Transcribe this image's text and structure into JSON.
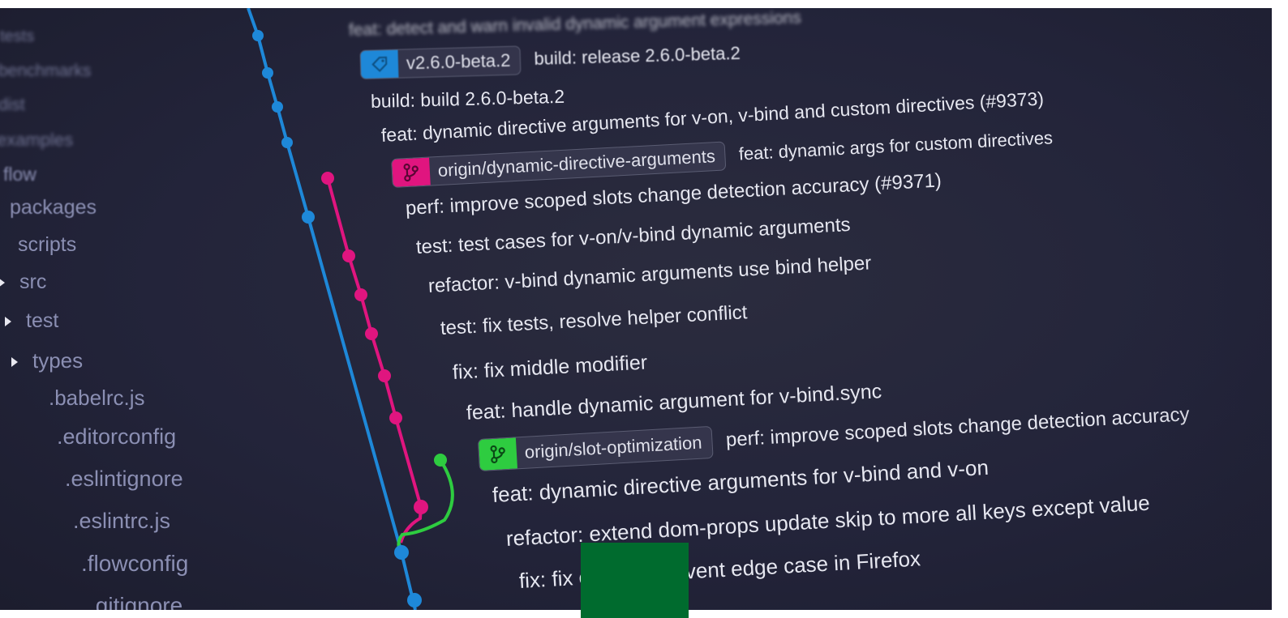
{
  "tree": {
    "items": [
      {
        "label": "tests",
        "caret": false
      },
      {
        "label": "benchmarks",
        "caret": false
      },
      {
        "label": "dist",
        "caret": false
      },
      {
        "label": "examples",
        "caret": false
      },
      {
        "label": "flow",
        "caret": false
      },
      {
        "label": "packages",
        "caret": false
      },
      {
        "label": "scripts",
        "caret": false
      },
      {
        "label": "src",
        "caret": true
      },
      {
        "label": "test",
        "caret": true
      },
      {
        "label": "types",
        "caret": true
      },
      {
        "label": ".babelrc.js",
        "caret": false
      },
      {
        "label": ".editorconfig",
        "caret": false
      },
      {
        "label": ".eslintignore",
        "caret": false
      },
      {
        "label": ".eslintrc.js",
        "caret": false
      },
      {
        "label": ".flowconfig",
        "caret": false
      },
      {
        "label": ".gitignore",
        "caret": false
      }
    ]
  },
  "commits": [
    {
      "message": "feat: detect and warn invalid dynamic argument expressions"
    },
    {
      "tag": "v2.6.0-beta.2",
      "message": "build: release 2.6.0-beta.2"
    },
    {
      "message": "build: build 2.6.0-beta.2"
    },
    {
      "message": "feat: dynamic directive arguments for v-on, v-bind and custom directives (#9373)"
    },
    {
      "tag": "origin/dynamic-directive-arguments",
      "message": "feat: dynamic args for custom directives"
    },
    {
      "message": "perf: improve scoped slots change detection accuracy (#9371)"
    },
    {
      "message": "test: test cases for v-on/v-bind dynamic arguments"
    },
    {
      "message": "refactor: v-bind dynamic arguments use bind helper"
    },
    {
      "message": "test: fix tests, resolve helper conflict"
    },
    {
      "message": "fix: fix middle modifier"
    },
    {
      "message": "feat: handle dynamic argument for v-bind.sync"
    },
    {
      "tag": "origin/slot-optimization",
      "message": "perf: improve scoped slots change detection accuracy"
    },
    {
      "message": "feat: dynamic directive arguments for v-bind and v-on"
    },
    {
      "message": "refactor: extend dom-props update skip to more all keys except value"
    },
    {
      "message": "fix: fix checkbox event edge case in Firefox"
    }
  ],
  "colors": {
    "background": "#23243a",
    "branch_blue": "#1e88d8",
    "branch_pink": "#e0157f",
    "branch_green": "#2ecc40",
    "tag_tag_bg": "#1e88d8",
    "tag_dynamic_bg": "#e0157f",
    "tag_slot_bg": "#2ecc40",
    "occluder": "#006b2e"
  },
  "icons": {
    "tag_icon": "tag-icon",
    "branch_icon": "git-branch-icon",
    "caret_icon": "caret-right-icon"
  }
}
